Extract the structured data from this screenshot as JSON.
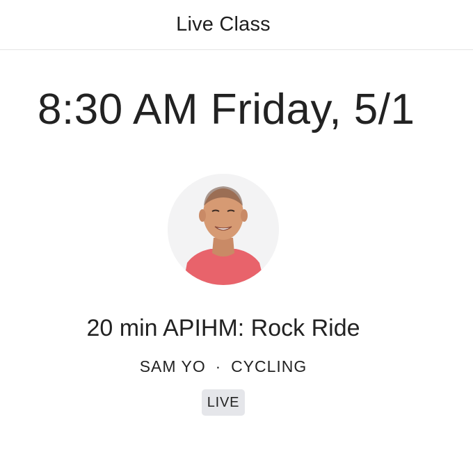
{
  "header": {
    "title": "Live Class"
  },
  "schedule": {
    "datetime": "8:30 AM Friday, 5/1"
  },
  "instructor": {
    "avatar_icon": "instructor-avatar",
    "name": "SAM YO"
  },
  "class": {
    "title": "20 min APIHM: Rock Ride",
    "separator": "·",
    "category": "CYCLING",
    "status_badge": "LIVE"
  },
  "colors": {
    "badge_background": "#e5e6ea",
    "avatar_background": "#f3f3f4",
    "shirt": "#e8636b"
  }
}
